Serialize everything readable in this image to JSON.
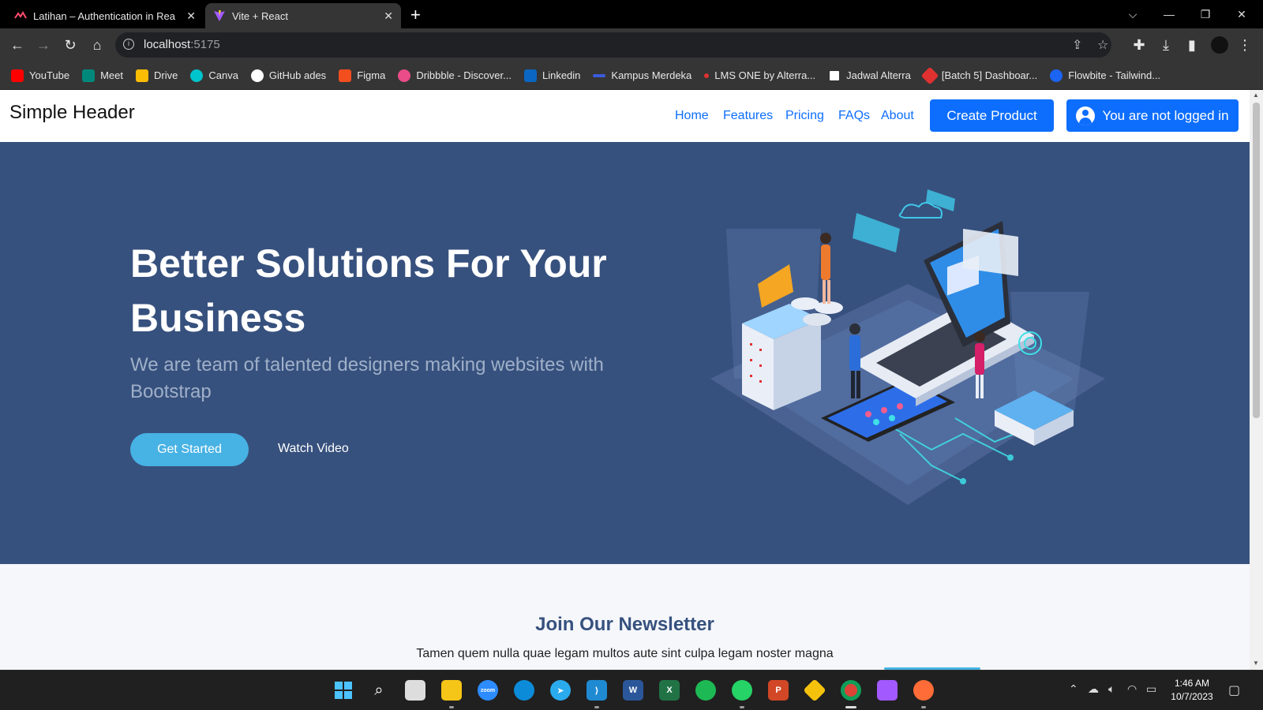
{
  "browser": {
    "tabs": [
      {
        "title": "Latihan – Authentication in Reac",
        "active": false,
        "favicon": "alterra-icon"
      },
      {
        "title": "Vite + React",
        "active": true,
        "favicon": "vite-icon"
      }
    ],
    "url_host": "localhost",
    "url_port": ":5175",
    "bookmarks": [
      {
        "label": "YouTube",
        "icon": "youtube-icon",
        "color": "#ff0000"
      },
      {
        "label": "Meet",
        "icon": "meet-icon",
        "color": "#00897b"
      },
      {
        "label": "Drive",
        "icon": "drive-icon",
        "color": "#fbbc04"
      },
      {
        "label": "Canva",
        "icon": "canva-icon",
        "color": "#00c4cc"
      },
      {
        "label": "GitHub ades",
        "icon": "github-icon",
        "color": "#ffffff"
      },
      {
        "label": "Figma",
        "icon": "figma-icon",
        "color": "#f24e1e"
      },
      {
        "label": "Dribbble - Discover...",
        "icon": "dribbble-icon",
        "color": "#ea4c89"
      },
      {
        "label": "Linkedin",
        "icon": "linkedin-icon",
        "color": "#0a66c2"
      },
      {
        "label": "Kampus Merdeka",
        "icon": "kampus-merdeka-icon",
        "color": "#3b5bdb"
      },
      {
        "label": "LMS ONE by Alterra...",
        "icon": "alterra-icon",
        "color": "#e03131"
      },
      {
        "label": "Jadwal Alterra",
        "icon": "notion-icon",
        "color": "#ffffff"
      },
      {
        "label": "[Batch 5] Dashboar...",
        "icon": "pin-icon",
        "color": "#e03131"
      },
      {
        "label": "Flowbite - Tailwind...",
        "icon": "flowbite-icon",
        "color": "#1c64f2"
      }
    ]
  },
  "page": {
    "brand": "Simple Header",
    "nav": [
      "Home",
      "Features",
      "Pricing",
      "FAQs",
      "About"
    ],
    "create_product": "Create Product",
    "login_status": "You are not logged in",
    "hero": {
      "title": "Better Solutions For Your Business",
      "subtitle": "We are team of talented designers making websites with Bootstrap",
      "cta_primary": "Get Started",
      "cta_secondary": "Watch Video"
    },
    "newsletter": {
      "title": "Join Our Newsletter",
      "subtitle": "Tamen quem nulla quae legam multos aute sint culpa legam noster magna"
    }
  },
  "taskbar": {
    "apps": [
      "windows-start-icon",
      "search-icon",
      "task-view-icon",
      "file-explorer-icon",
      "zoom-icon",
      "edge-icon",
      "telegram-icon",
      "vscode-icon",
      "word-icon",
      "excel-icon",
      "spotify-icon",
      "whatsapp-icon",
      "powerpoint-icon",
      "git-icon",
      "chrome-icon",
      "figma-icon",
      "postman-icon"
    ],
    "time": "1:46 AM",
    "date": "10/7/2023"
  },
  "colors": {
    "hero_bg": "#37517e",
    "accent": "#47b2e4",
    "bootstrap_primary": "#0d6efd"
  }
}
